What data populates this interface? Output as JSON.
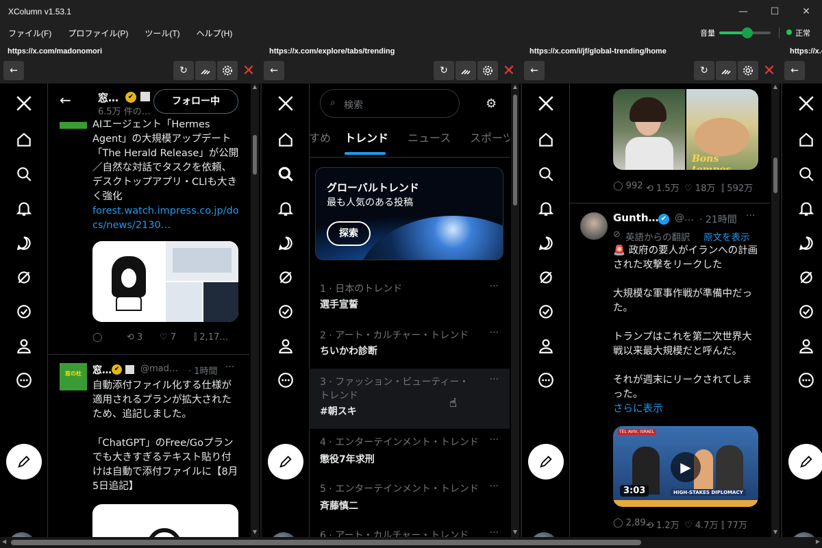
{
  "window": {
    "title": "XColumn v1.53.1",
    "minimize": "—",
    "maximize": "☐",
    "close": "✕"
  },
  "menu": {
    "items": [
      "ファイル(F)",
      "プロファイル(P)",
      "ツール(T)",
      "ヘルプ(H)"
    ]
  },
  "status": {
    "volume_label": "音量",
    "volume_level": 0.55,
    "status_text": "正常",
    "status_color": "#22c55e"
  },
  "icons": {
    "back": "←",
    "reload": "↻",
    "clean": "broom-icon",
    "settings": "⚙",
    "close_col": "✕",
    "more": "···",
    "verified": "✔",
    "play": "▶"
  },
  "colors": {
    "accent": "#1d9bf0",
    "gold": "#e2b719",
    "danger": "#e23b3b"
  },
  "columns": [
    {
      "url": "https://x.com/madonomori",
      "profile_header": {
        "name": "窓…",
        "followers": "6.5万 件の…",
        "follow_button": "フォロー中"
      },
      "post1": {
        "text": "AIエージェント「Hermes Agent」の大規模アップデート「The Herald Release」が公開／自然な対話でタスクを依頼、デスクトップアプリ・CLIも大きく強化",
        "link": "forest.watch.impress.co.jp/docs/news/2130…",
        "stats": {
          "retweets": "3",
          "likes": "7",
          "views": "2,17…"
        }
      },
      "post2": {
        "name": "窓…",
        "handle": "@mad…",
        "time": "· 1時間",
        "text1": "自動添付ファイル化する仕様が適用されるプランが拡大されたため、追記しました。",
        "text2": "「ChatGPT」のFree/Goプランでも大きすぎるテキスト貼り付けは自動で添付ファイルに【8月5日追記】",
        "avatar_text": "窓の杜"
      }
    },
    {
      "url": "https://x.com/explore/tabs/trending",
      "search": {
        "placeholder": "検索"
      },
      "tabs": [
        "すめ",
        "トレンド",
        "ニュース",
        "スポーツ"
      ],
      "banner": {
        "title": "グローバルトレンド",
        "subtitle": "最も人気のある投稿",
        "button": "探索"
      },
      "trends": [
        {
          "meta": "1 · 日本のトレンド",
          "name": "選手宣誓"
        },
        {
          "meta": "2 · アート・カルチャー・トレンド",
          "name": "ちいかわ診断"
        },
        {
          "meta": "3 · ファッション・ビューティー・トレンド",
          "name": "#朝スキ"
        },
        {
          "meta": "4 · エンターテインメント・トレンド",
          "name": "懲役7年求刑"
        },
        {
          "meta": "5 · エンターテインメント・トレンド",
          "name": "斉藤慎二"
        },
        {
          "meta": "6 · アート・カルチャー・トレンド",
          "name": ""
        }
      ]
    },
    {
      "url": "https://x.com/i/jf/global-trending/home",
      "post0_stats": {
        "replies": "992",
        "retweets": "1.5万",
        "likes": "18万",
        "views": "592万"
      },
      "image_text": "Bons tempos",
      "post": {
        "name": "Gunth…",
        "handle": "@…",
        "time": "· 21時間",
        "translated_from": "英語からの翻訳",
        "show_original": "原文を表示",
        "p1": "🚨 政府の要人がイランへの計画された攻撃をリークした",
        "p2": "大規模な軍事作戦が準備中だった。",
        "p3": "トランプはこれを第二次世界大戦以来最大規模だと呼んだ。",
        "p4": "それが週末にリークされてしまった。",
        "show_more": "さらに表示",
        "video_duration": "3:03",
        "video_banner": "HIGH-STAKES DIPLOMACY",
        "video_ticker": "TEL AVIV, ISRAEL",
        "stats": {
          "replies": "2,89…",
          "retweets": "1.2万",
          "likes": "4.7万",
          "views": "77万"
        }
      }
    },
    {
      "url": "https://x.com"
    }
  ]
}
